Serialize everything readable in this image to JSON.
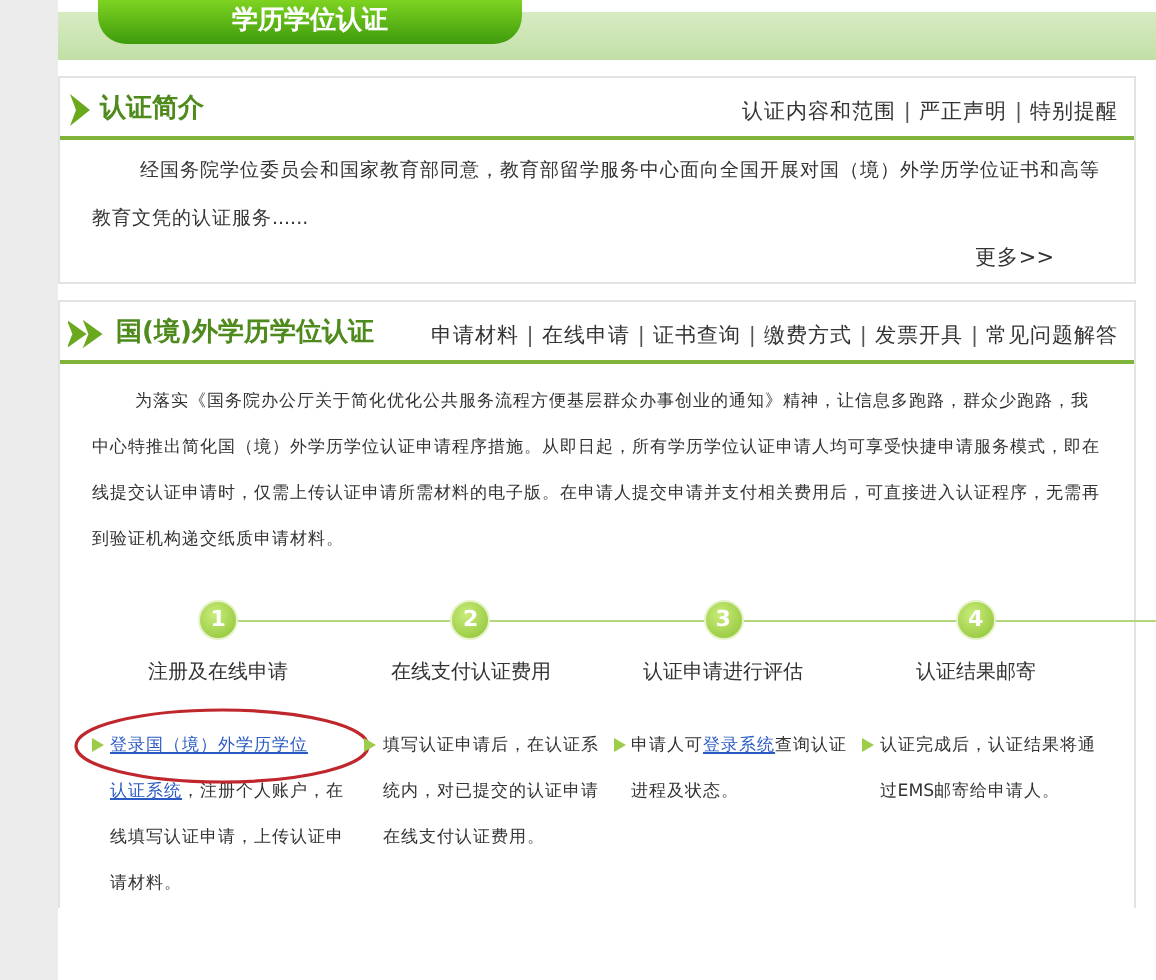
{
  "header_tab": {
    "title": "学历学位认证"
  },
  "intro": {
    "title": "认证简介",
    "separator": "|",
    "links": [
      "认证内容和范围",
      "严正声明",
      "特别提醒"
    ],
    "text": "经国务院学位委员会和国家教育部同意，教育部留学服务中心面向全国开展对国（境）外学历学位证书和高等教育文凭的认证服务......",
    "more": "更多>>"
  },
  "section": {
    "title": "国(境)外学历学位认证",
    "separator": "|",
    "links": [
      "申请材料",
      "在线申请",
      "证书查询",
      "缴费方式",
      "发票开具",
      "常见问题解答"
    ],
    "notice": "为落实《国务院办公厅关于简化优化公共服务流程方便基层群众办事创业的通知》精神，让信息多跑路，群众少跑路，我中心特推出简化国（境）外学历学位认证申请程序措施。从即日起，所有学历学位认证申请人均可享受快捷申请服务模式，即在线提交认证申请时，仅需上传认证申请所需材料的电子版。在申请人提交申请并支付相关费用后，可直接进入认证程序，无需再到验证机构递交纸质申请材料。",
    "steps": [
      {
        "number": "1",
        "label": "注册及在线申请"
      },
      {
        "number": "2",
        "label": "在线支付认证费用"
      },
      {
        "number": "3",
        "label": "认证申请进行评估"
      },
      {
        "number": "4",
        "label": "认证结果邮寄"
      }
    ],
    "instructions": [
      {
        "circled": true,
        "parts": [
          {
            "text": "登录国（境）外学历学位",
            "kind": "link"
          },
          {
            "text": "认证系统",
            "kind": "link"
          },
          {
            "text": "，注册个人账户，在线填写认证申请，上传认证申请材料。",
            "kind": "text"
          }
        ]
      },
      {
        "circled": false,
        "parts": [
          {
            "text": "填写认证申请后，在认证系统内，对已提交的认证申请在线支付认证费用。",
            "kind": "text"
          }
        ]
      },
      {
        "circled": false,
        "parts": [
          {
            "text": "申请人可",
            "kind": "text"
          },
          {
            "text": "登录系统",
            "kind": "link"
          },
          {
            "text": "查询认证进程及状态。",
            "kind": "text"
          }
        ]
      },
      {
        "circled": false,
        "parts": [
          {
            "text": "认证完成后，认证结果将通过EMS邮寄给申请人。",
            "kind": "text"
          }
        ]
      }
    ]
  }
}
